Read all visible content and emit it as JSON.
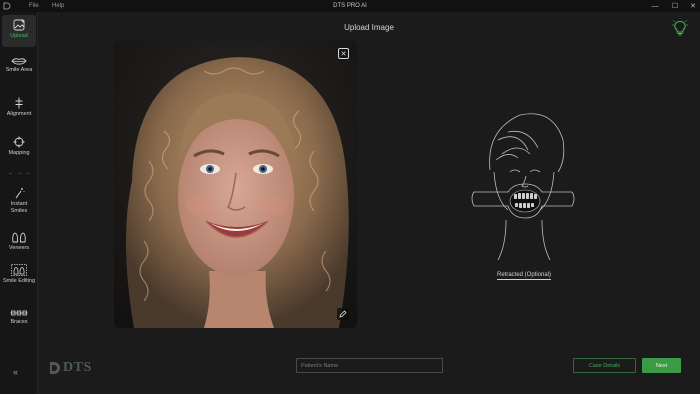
{
  "titlebar": {
    "title": "DTS PRO AI",
    "menu": [
      "File",
      "Help"
    ],
    "controls": {
      "minimize": "—",
      "maximize": "☐",
      "close": "✕"
    }
  },
  "sidebar": {
    "items": [
      {
        "label": "Upload",
        "icon": "upload-image-icon",
        "active": true
      },
      {
        "label": "Smile Area",
        "icon": "lips-icon"
      },
      {
        "label": "Alignment",
        "icon": "alignment-icon"
      },
      {
        "label": "Mapping",
        "icon": "crosshair-icon"
      },
      {
        "label": "Instant Smiles",
        "icon": "magic-wand-icon"
      },
      {
        "label": "Veneers",
        "icon": "tooth-icon"
      },
      {
        "label": "Smile Editing",
        "icon": "smile-editing-icon"
      },
      {
        "label": "Braces",
        "icon": "braces-icon"
      }
    ],
    "collapse": "«"
  },
  "main": {
    "title": "Upload Image",
    "retracted_label": "Retracted (Optional)",
    "close_symbol": "✕"
  },
  "footer": {
    "logo_text": "DTS",
    "patient_placeholder": "Patient's Name",
    "patient_value": "",
    "case_details_label": "Case Details",
    "next_label": "Next"
  },
  "colors": {
    "accent": "#3fbf52",
    "background": "#1b1b1c",
    "sidebar": "#161617",
    "next_button": "#3b9a46"
  }
}
